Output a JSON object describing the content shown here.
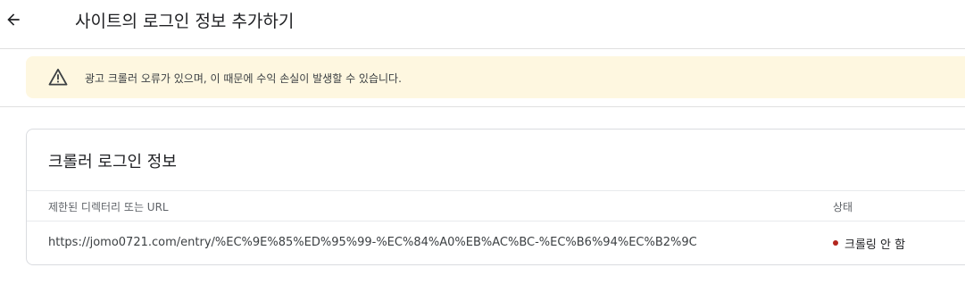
{
  "header": {
    "title": "사이트의 로그인 정보 추가하기",
    "back_icon": "arrow-left-icon"
  },
  "alert": {
    "icon": "warning-icon",
    "message": "광고 크롤러 오류가 있으며, 이 때문에 수익 손실이 발생할 수 있습니다."
  },
  "card": {
    "title": "크롤러 로그인 정보",
    "columns": {
      "url": "제한된 디렉터리 또는 URL",
      "status": "상태"
    },
    "rows": [
      {
        "url": "https://jomo0721.com/entry/%EC%9E%85%ED%95%99-%EC%84%A0%EB%AC%BC-%EC%B6%94%EC%B2%9C",
        "status": "크롤링 안 함",
        "status_color": "#b3261e"
      }
    ]
  }
}
